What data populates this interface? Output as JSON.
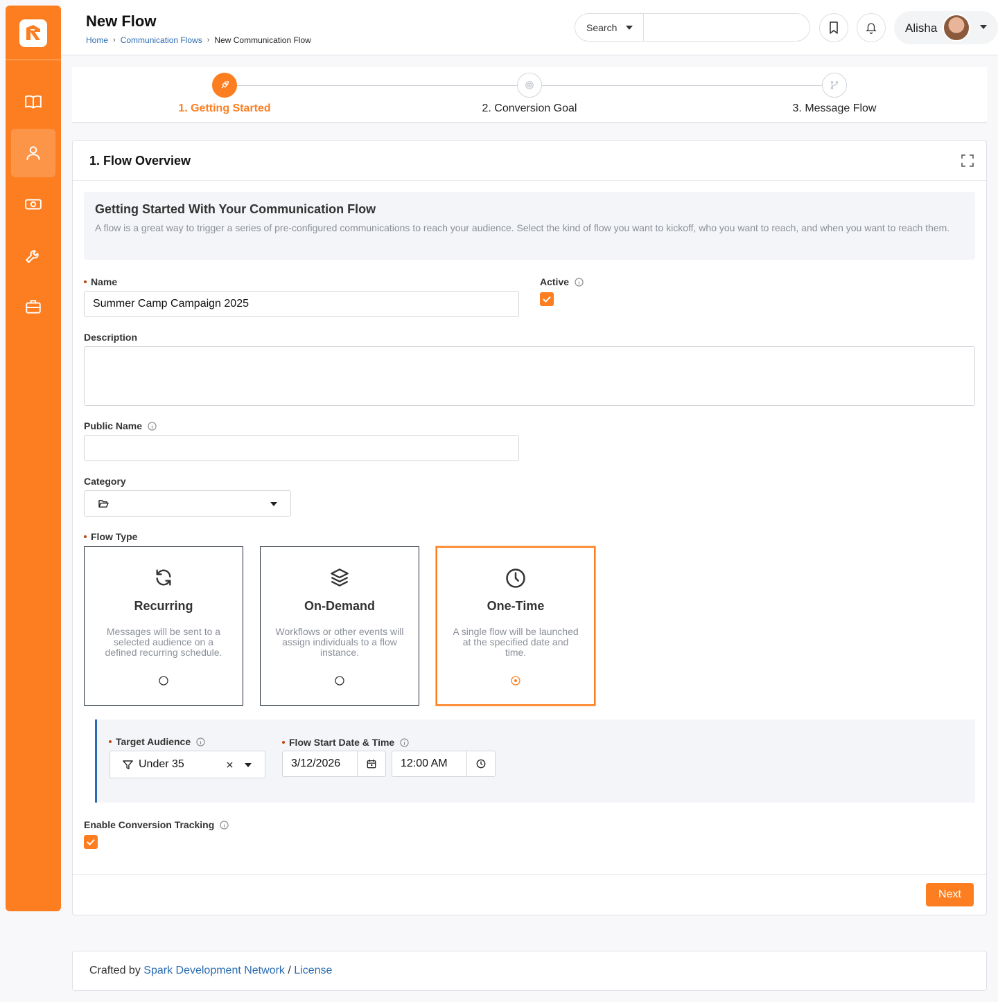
{
  "header": {
    "title": "New Flow",
    "breadcrumb": [
      "Home",
      "Communication Flows",
      "New Communication Flow"
    ],
    "search_button": "Search",
    "search_placeholder": "",
    "user_name": "Alisha"
  },
  "sidebar": {
    "items": [
      {
        "icon": "book-icon"
      },
      {
        "icon": "user-icon",
        "active": true
      },
      {
        "icon": "money-icon"
      },
      {
        "icon": "wrench-icon"
      },
      {
        "icon": "briefcase-icon"
      }
    ]
  },
  "steps": [
    {
      "label": "1. Getting Started",
      "active": true,
      "icon": "rocket-icon"
    },
    {
      "label": "2. Conversion Goal",
      "active": false,
      "icon": "target-icon"
    },
    {
      "label": "3. Message Flow",
      "active": false,
      "icon": "flow-icon"
    }
  ],
  "panel": {
    "title": "1. Flow Overview",
    "intro_title": "Getting Started With Your Communication Flow",
    "intro_text": "A flow is a great way to trigger a series of pre-configured communications to reach your audience. Select the kind of flow you want to kickoff, who you want to reach, and when you want to reach them."
  },
  "form": {
    "name_label": "Name",
    "name_value": "Summer Camp Campaign 2025",
    "active_label": "Active",
    "active_checked": true,
    "description_label": "Description",
    "description_value": "",
    "public_name_label": "Public Name",
    "public_name_value": "",
    "category_label": "Category",
    "category_value": "",
    "flow_type_label": "Flow Type",
    "flow_types": [
      {
        "title": "Recurring",
        "desc": "Messages will be sent to a selected audience on a defined recurring schedule.",
        "icon": "refresh-icon",
        "selected": false
      },
      {
        "title": "On-Demand",
        "desc": "Workflows or other events will assign individuals to a flow instance.",
        "icon": "layers-icon",
        "selected": false
      },
      {
        "title": "One-Time",
        "desc": "A single flow will be launched at the specified date and time.",
        "icon": "clock-icon",
        "selected": true
      }
    ],
    "target_audience_label": "Target Audience",
    "target_audience_value": "Under 35",
    "start_label": "Flow Start Date & Time",
    "start_date": "3/12/2026",
    "start_time": "12:00 AM",
    "conversion_label": "Enable Conversion Tracking",
    "conversion_checked": true
  },
  "actions": {
    "next": "Next"
  },
  "footer": {
    "prefix": "Crafted by",
    "link1": "Spark Development Network",
    "sep": "/",
    "link2": "License"
  },
  "colors": {
    "accent": "#fd7e20",
    "link": "#2b6cb0"
  }
}
